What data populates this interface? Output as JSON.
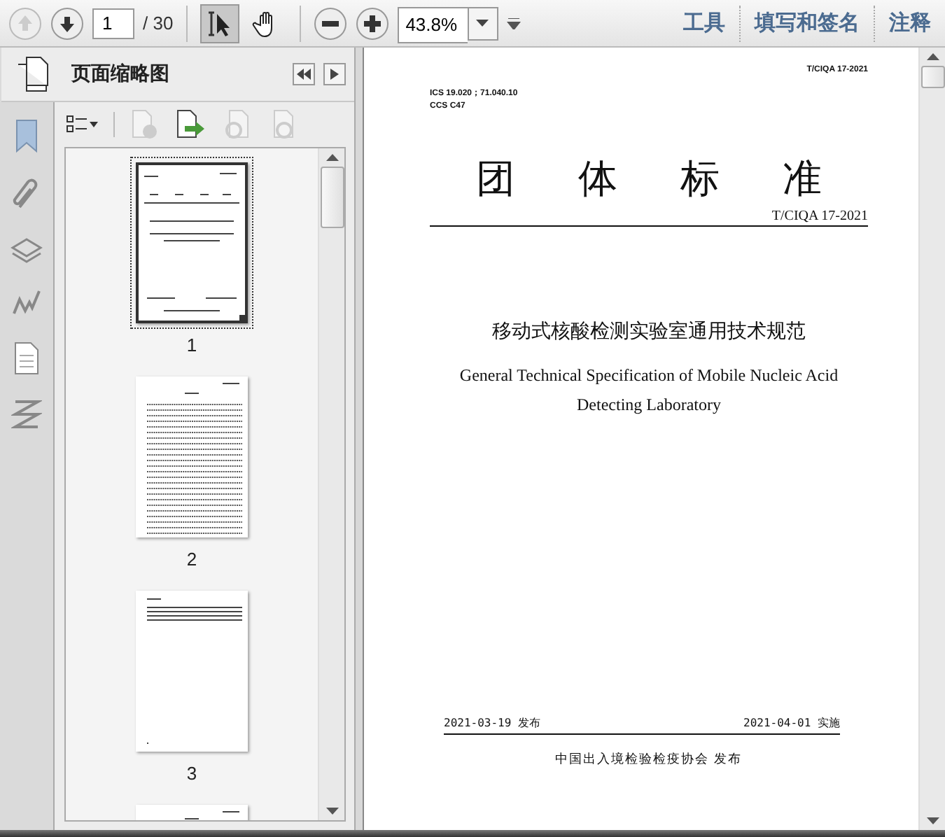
{
  "toolbar": {
    "page_field": {
      "value": "1"
    },
    "page_total": "/ 30",
    "tools": [
      {
        "kind": "select",
        "selected": true
      },
      {
        "kind": "hand",
        "selected": false
      }
    ],
    "zoom_field": {
      "value": "43.8%"
    },
    "menu_links": [
      "工具",
      "填写和签名",
      "注释"
    ]
  },
  "sidebar": {
    "title": "页面缩略图",
    "thumbnails": [
      {
        "kind": "cover",
        "label": "1",
        "selected": true
      },
      {
        "kind": "toc",
        "label": "2",
        "selected": false
      },
      {
        "kind": "short",
        "label": "3",
        "selected": false
      },
      {
        "kind": "partial",
        "selected": false
      }
    ]
  },
  "document": {
    "code_top": "T/CIQA 17-2021",
    "ics": "ICS 19.020；71.040.10",
    "ccs": "CCS C47",
    "heading": "团 体 标 准",
    "code": "T/CIQA 17-2021",
    "title_cn": "移动式核酸检测实验室通用技术规范",
    "title_en": "General Technical Specification of Mobile Nucleic Acid Detecting Laboratory",
    "issue_date": "2021-03-19 发布",
    "impl_date": "2021-04-01 实施",
    "publisher": "中国出入境检验检疫协会 发布"
  }
}
